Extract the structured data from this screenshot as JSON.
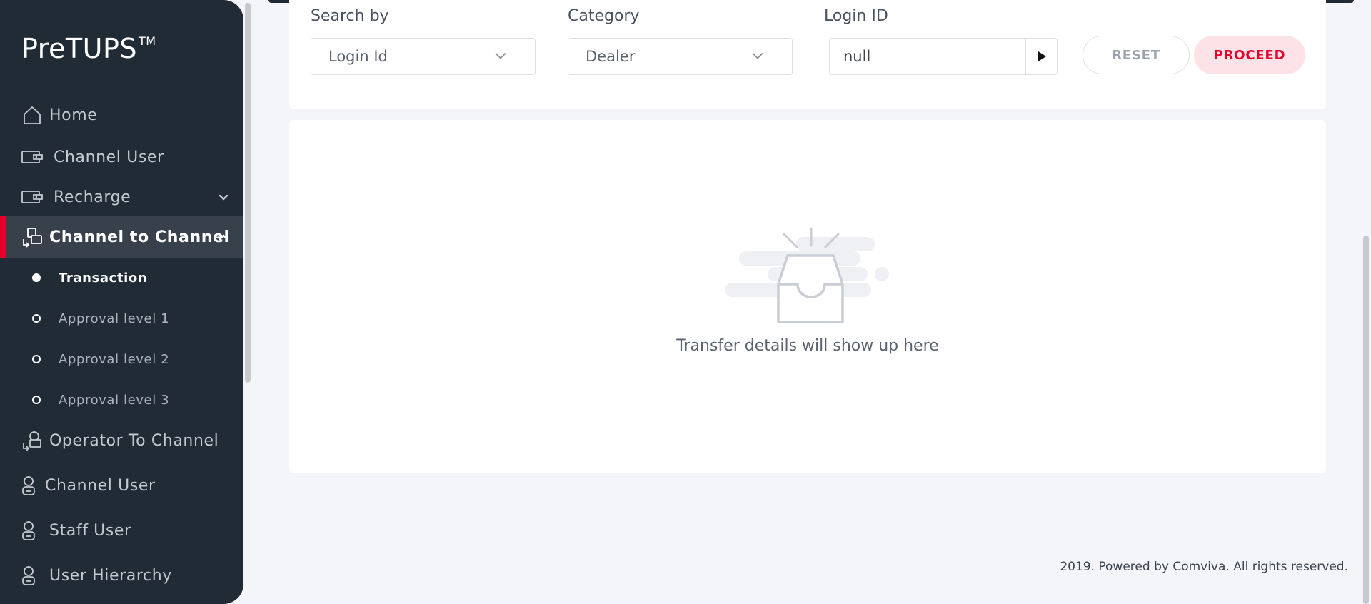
{
  "app": {
    "logo": "PreTUPS",
    "logo_mark": "TM"
  },
  "sidebar": {
    "items": [
      {
        "label": "Home",
        "icon": "home-icon"
      },
      {
        "label": "Channel User",
        "icon": "wallet-icon"
      },
      {
        "label": "Recharge",
        "icon": "wallet-icon",
        "expandable": true
      },
      {
        "label": "Channel to Channel",
        "icon": "transfer-icon",
        "active": true,
        "expanded": true
      },
      {
        "label": "Operator To Channel",
        "icon": "operator-transfer-icon"
      },
      {
        "label": "Channel User",
        "icon": "user-icon"
      },
      {
        "label": "Staff User",
        "icon": "user-icon"
      },
      {
        "label": "User Hierarchy",
        "icon": "user-icon"
      }
    ],
    "sub_items": [
      {
        "label": "Transaction",
        "active": true
      },
      {
        "label": "Approval level 1"
      },
      {
        "label": "Approval level 2"
      },
      {
        "label": "Approval level 3"
      }
    ]
  },
  "filters": {
    "search_by": {
      "label": "Search by",
      "value": "Login Id"
    },
    "category": {
      "label": "Category",
      "value": "Dealer"
    },
    "login_id": {
      "label": "Login ID",
      "value": "null"
    },
    "reset_label": "RESET",
    "proceed_label": "PROCEED"
  },
  "results": {
    "empty_text": "Transfer details will show up here"
  },
  "footer": {
    "text": "2019. Powered by Comviva. All rights reserved."
  },
  "colors": {
    "sidebar_bg": "#212b36",
    "accent": "#e4002b",
    "proceed_bg": "#fde3e7",
    "page_bg": "#f4f5f9"
  }
}
